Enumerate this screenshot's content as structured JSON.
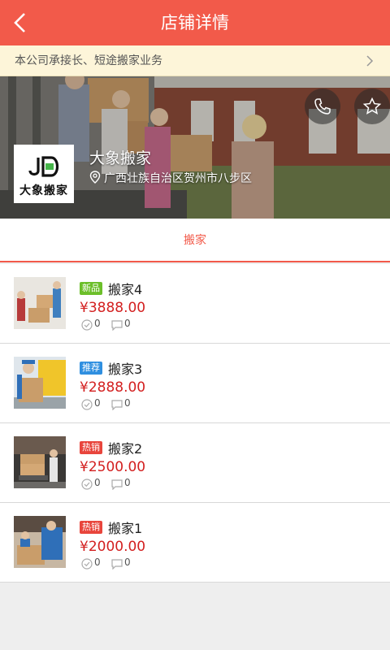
{
  "header": {
    "title": "店铺详情",
    "back_icon": "chevron-left-icon"
  },
  "notice": {
    "text": "本公司承接长、短途搬家业务",
    "arrow_icon": "chevron-right-icon"
  },
  "shop": {
    "name": "大象搬家",
    "address": "广西壮族自治区贺州市八步区",
    "logo_text": "大象搬家",
    "logo_mark": "JD",
    "location_icon": "location-pin-icon",
    "phone_icon": "phone-icon",
    "favorite_icon": "star-icon"
  },
  "tabs": [
    {
      "label": "搬家",
      "active": true
    }
  ],
  "products": [
    {
      "badge": "新品",
      "badge_color": "#6cbf2a",
      "title": "搬家4",
      "price": "¥3888.00",
      "likes": "0",
      "comments": "0"
    },
    {
      "badge": "推荐",
      "badge_color": "#2f8fe0",
      "title": "搬家3",
      "price": "¥2888.00",
      "likes": "0",
      "comments": "0"
    },
    {
      "badge": "热销",
      "badge_color": "#e8453c",
      "title": "搬家2",
      "price": "¥2500.00",
      "likes": "0",
      "comments": "0"
    },
    {
      "badge": "热销",
      "badge_color": "#e8453c",
      "title": "搬家1",
      "price": "¥2000.00",
      "likes": "0",
      "comments": "0"
    }
  ],
  "colors": {
    "accent": "#f25a4a",
    "price": "#d32020",
    "notice_bg": "#fdf5d9"
  }
}
